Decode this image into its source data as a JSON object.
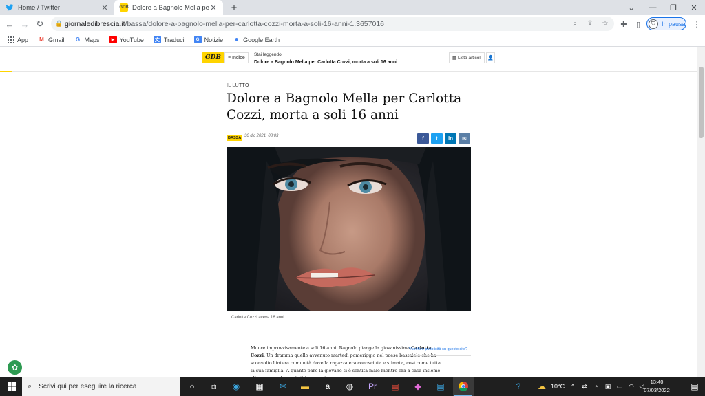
{
  "browser": {
    "tabs": [
      {
        "title": "Home / Twitter",
        "favicon": "twitter-icon",
        "close": "✕"
      },
      {
        "title": "Dolore a Bagnolo Mella per Carlo",
        "favicon": "gdb-icon",
        "favicon_text": "GDB",
        "close": "✕"
      }
    ],
    "new_tab": "+",
    "url_domain": "giornaledibrescia.it",
    "url_path": "/bassa/dolore-a-bagnolo-mella-per-carlotta-cozzi-morta-a-soli-16-anni-1.3657016",
    "profile_label": "In pausa",
    "bookmarks": [
      {
        "label": "App",
        "icon": "apps-grid-icon"
      },
      {
        "label": "Gmail",
        "icon": "gmail-icon",
        "glyph": "M"
      },
      {
        "label": "Maps",
        "icon": "maps-icon",
        "glyph": "G"
      },
      {
        "label": "YouTube",
        "icon": "youtube-icon",
        "glyph": "▶"
      },
      {
        "label": "Traduci",
        "icon": "translate-icon",
        "glyph": "文"
      },
      {
        "label": "Notizie",
        "icon": "news-icon",
        "glyph": "G"
      },
      {
        "label": "Google Earth",
        "icon": "earth-icon",
        "glyph": "●"
      }
    ]
  },
  "site": {
    "logo": "GDB",
    "menu_label": "≡ Indice",
    "reading_label": "Stai leggendo:",
    "reading_title": "Dolore a Bagnolo Mella per Carlotta Cozzi, morta a soli 16 anni",
    "list_label": "▦ Lista articoli",
    "user_glyph": "👤"
  },
  "article": {
    "category": "IL LUTTO",
    "headline": "Dolore a Bagnolo Mella per Carlotta Cozzi, morta a soli 16 anni",
    "section": "BASSA",
    "date": "30 dic 2021, 08:03",
    "share": [
      {
        "name": "facebook",
        "glyph": "f",
        "color": "#3b5998"
      },
      {
        "name": "twitter",
        "glyph": "t",
        "color": "#1da1f2"
      },
      {
        "name": "linkedin",
        "glyph": "in",
        "color": "#0077b5"
      },
      {
        "name": "email",
        "glyph": "✉",
        "color": "#5b7fa6"
      }
    ],
    "caption": "Carlotta Cozzi aveva 16 anni",
    "body_before": "Muore improvvisamente a soli 16 anni: Bagnolo piange la giovanissima ",
    "body_name": "Carlotta Cozzi",
    "body_after": ". Un dramma quello avvenuto martedì pomeriggio nel paese bassaiolo che ha sconvolto l'intera comunità dove la ragazza era conosciuta e stimata, così come tutta la sua famiglia. A quanto pare la giovane si è sentita male mentre era a casa insieme alla mamma. Immediati i soccorsi",
    "ad_link": "Vuoi fare pubblicità su questo sito?"
  },
  "taskbar": {
    "search_placeholder": "Scrivi qui per eseguire la ricerca",
    "temperature": "10°C",
    "time": "13:40",
    "date": "07/03/2022"
  },
  "colors": {
    "accent_yellow": "#ffd400",
    "chrome_blue": "#1a73e8"
  }
}
